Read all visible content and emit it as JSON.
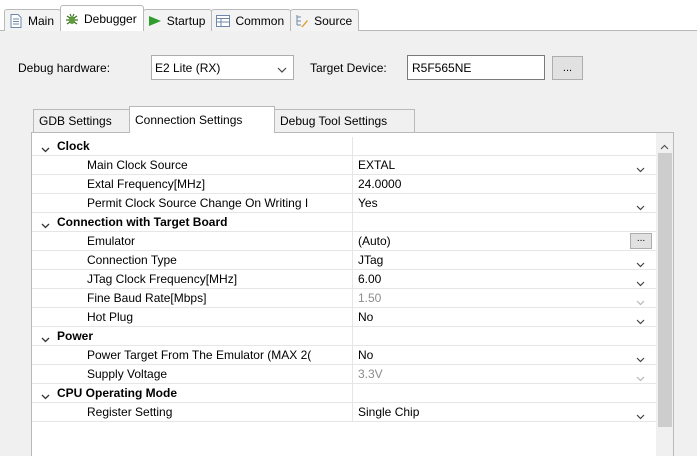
{
  "tabs": [
    {
      "label": "Main",
      "icon": "document-icon"
    },
    {
      "label": "Debugger",
      "icon": "bug-icon"
    },
    {
      "label": "Startup",
      "icon": "play-arrow-icon"
    },
    {
      "label": "Common",
      "icon": "table-icon"
    },
    {
      "label": "Source",
      "icon": "source-lookup-icon"
    }
  ],
  "debug": {
    "hardware_label": "Debug hardware:",
    "hardware_value": "E2 Lite (RX)",
    "target_label": "Target Device:",
    "target_value": "R5F565NE",
    "browse_label": "..."
  },
  "subtabs": [
    "GDB Settings",
    "Connection Settings",
    "Debug Tool Settings"
  ],
  "rows": [
    {
      "type": "category",
      "name": "Clock"
    },
    {
      "type": "prop",
      "name": "Main Clock Source",
      "value": "EXTAL",
      "control": "dropdown"
    },
    {
      "type": "prop",
      "name": "Extal Frequency[MHz]",
      "value": "24.0000",
      "control": "none"
    },
    {
      "type": "prop",
      "name": "Permit Clock Source Change On Writing I",
      "value": "Yes",
      "control": "dropdown"
    },
    {
      "type": "category",
      "name": "Connection with Target Board"
    },
    {
      "type": "prop",
      "name": "Emulator",
      "value": "(Auto)",
      "control": "button",
      "button_label": "..."
    },
    {
      "type": "prop",
      "name": "Connection Type",
      "value": "JTag",
      "control": "dropdown"
    },
    {
      "type": "prop",
      "name": "JTag Clock Frequency[MHz]",
      "value": "6.00",
      "control": "dropdown"
    },
    {
      "type": "prop",
      "name": "Fine Baud Rate[Mbps]",
      "value": "1.50",
      "control": "dropdown",
      "disabled": true
    },
    {
      "type": "prop",
      "name": "Hot Plug",
      "value": "No",
      "control": "dropdown"
    },
    {
      "type": "category",
      "name": "Power"
    },
    {
      "type": "prop",
      "name": "Power Target From The Emulator (MAX 2(",
      "value": "No",
      "control": "dropdown"
    },
    {
      "type": "prop",
      "name": "Supply Voltage",
      "value": "3.3V",
      "control": "dropdown",
      "disabled": true
    },
    {
      "type": "category",
      "name": "CPU Operating Mode"
    },
    {
      "type": "prop",
      "name": "Register Setting",
      "value": "Single Chip",
      "control": "dropdown"
    }
  ],
  "colors": {
    "accent": "#2f9e2f",
    "border": "#b9b9b9",
    "disabled_text": "#8c8c8c"
  }
}
